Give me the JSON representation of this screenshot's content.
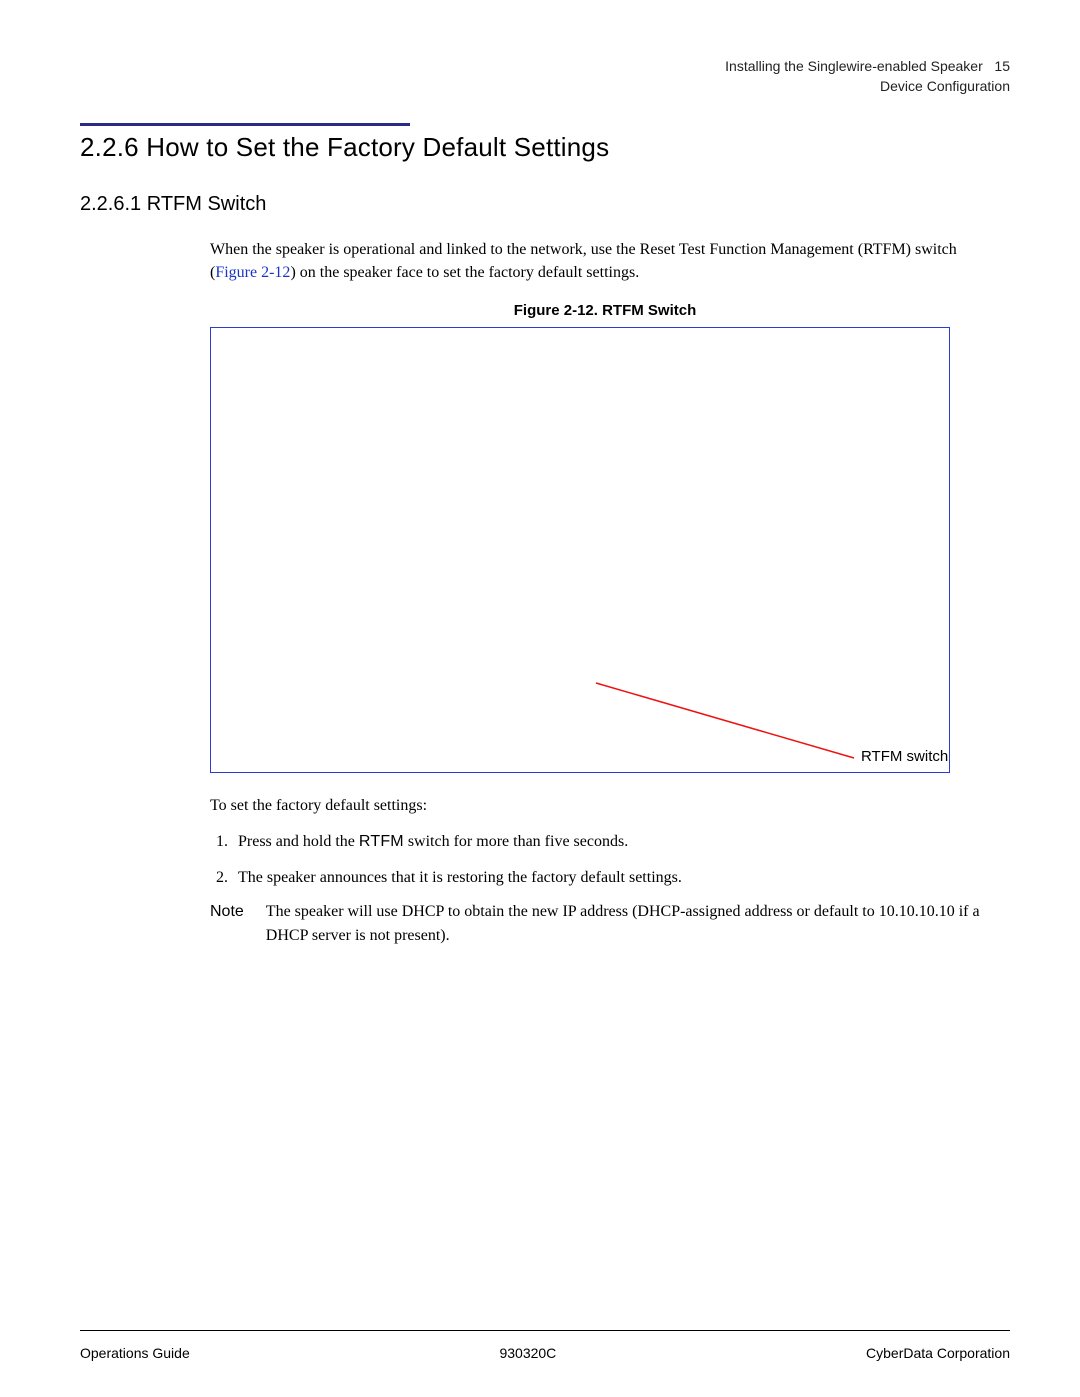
{
  "header": {
    "line1": "Installing the Singlewire-enabled Speaker",
    "page_number": "15",
    "line2": "Device Configuration"
  },
  "section": {
    "number": "2.2.6",
    "title": "How to Set the Factory Default Settings"
  },
  "subsection": {
    "number": "2.2.6.1",
    "title": "RTFM Switch"
  },
  "intro": {
    "pre": "When the speaker is operational and linked to the network, use the Reset Test Function Management (RTFM) switch (",
    "ref": "Figure 2-12",
    "post": ") on the speaker face to set the factory default settings."
  },
  "figure": {
    "caption": "Figure 2-12. RTFM Switch",
    "callout_label": "RTFM switch"
  },
  "lead": "To set the factory default settings:",
  "steps": {
    "s1_pre": "Press and hold the ",
    "s1_rtfm": "RTFM",
    "s1_post": " switch for more than five seconds.",
    "s2": "The speaker announces that it is restoring the factory default settings."
  },
  "note": {
    "label": "Note",
    "text": "The speaker will use DHCP to obtain the new IP address (DHCP-assigned address or default to 10.10.10.10 if a DHCP server is not present)."
  },
  "footer": {
    "left": "Operations Guide",
    "center": "930320C",
    "right": "CyberData Corporation"
  }
}
